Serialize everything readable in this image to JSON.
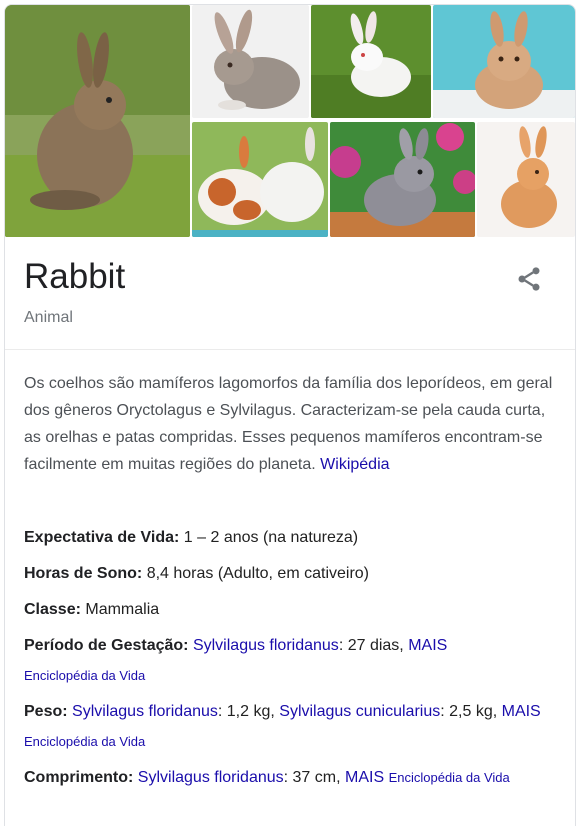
{
  "entity": {
    "title": "Rabbit",
    "subtitle": "Animal"
  },
  "gallery": {
    "images": [
      {
        "name": "rabbit-photo-wild-brown"
      },
      {
        "name": "rabbit-photo-gray-white-bg"
      },
      {
        "name": "rabbit-photo-white-grass"
      },
      {
        "name": "rabbit-photo-tan-blue-bg"
      },
      {
        "name": "rabbit-photo-white-orange-pair"
      },
      {
        "name": "rabbit-photo-gray-flowers"
      },
      {
        "name": "rabbit-photo-orange-white-bg"
      }
    ]
  },
  "description": {
    "text": "Os coelhos são mamíferos lagomorfos da família dos leporídeos, em geral dos gêneros Oryctolagus e Sylvilagus. Caracterizam-se pela cauda curta, as orelhas e patas compridas. Esses pequenos mamíferos encontram-se facilmente em muitas regiões do planeta.",
    "source_link": "Wikipédia"
  },
  "facts": {
    "life_expectancy": {
      "label": "Expectativa de Vida:",
      "value": "1 – 2 anos (na natureza)"
    },
    "sleep_hours": {
      "label": "Horas de Sono:",
      "value": "8,4 horas (Adulto, em cativeiro)"
    },
    "class": {
      "label": "Classe:",
      "value": "Mammalia"
    },
    "gestation": {
      "label": "Período de Gestação:",
      "species1": "Sylvilagus floridanus",
      "value1": ": 27 dias,",
      "more": "MAIS",
      "source": "Enciclopédia da Vida"
    },
    "weight": {
      "label": "Peso:",
      "species1": "Sylvilagus floridanus",
      "value1": ": 1,2 kg,",
      "species2": "Sylvilagus cunicularius",
      "value2": ": 2,5 kg,",
      "more": "MAIS",
      "source": "Enciclopédia da Vida"
    },
    "length": {
      "label": "Comprimento:",
      "species1": "Sylvilagus floridanus",
      "value1": ": 37 cm,",
      "more": "MAIS",
      "source": "Enciclopédia da Vida"
    }
  },
  "icons": {
    "share": "share-icon"
  },
  "colors": {
    "link": "#1a0dab",
    "title": "#202124",
    "muted": "#70757a",
    "body": "#4d5156"
  }
}
